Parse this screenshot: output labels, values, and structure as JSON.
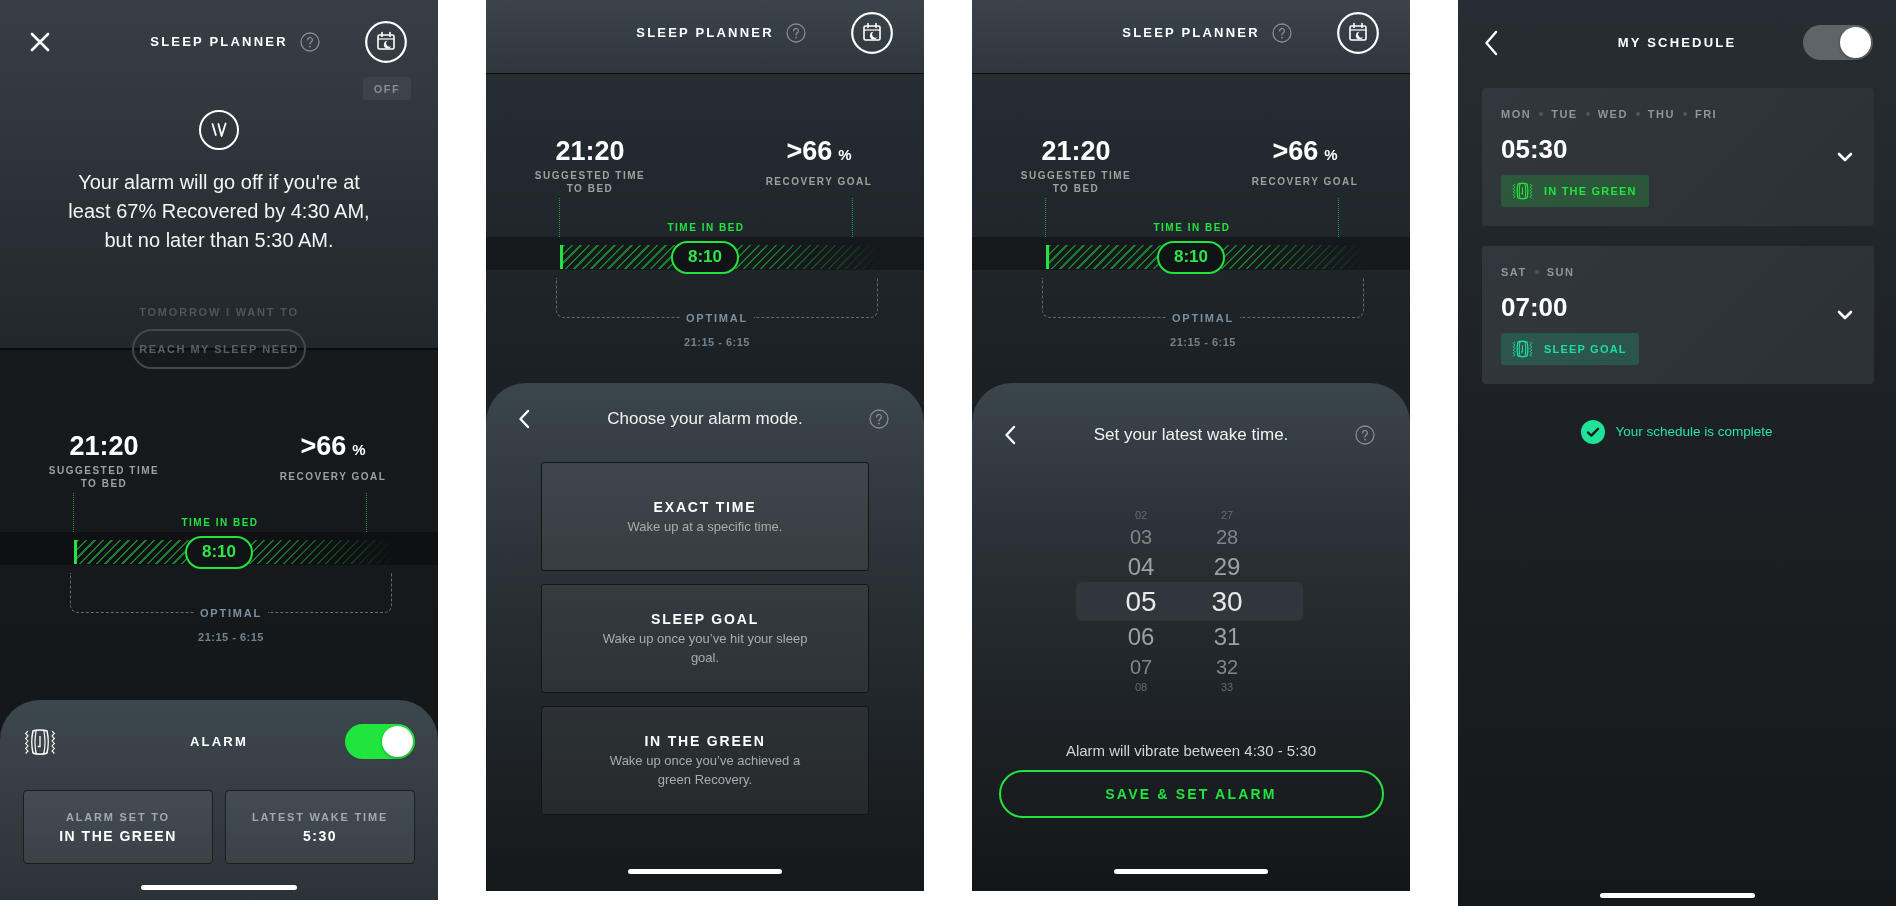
{
  "screens": [
    {
      "kind": "summary",
      "header": {
        "title": "SLEEP PLANNER",
        "badge": "OFF"
      },
      "message": "Your alarm will go off if you're at least 67% Recovered by 4:30 AM, but no later than 5:30 AM.",
      "prompt": {
        "label": "TOMORROW I WANT TO",
        "button": "REACH MY SLEEP NEED"
      },
      "plan": {
        "bedtime": "21:20",
        "bedtime_label": "SUGGESTED TIME TO BED",
        "recovery_goal": ">66",
        "recovery_unit": "%",
        "recovery_label": "RECOVERY GOAL",
        "time_in_bed_label": "TIME IN BED",
        "time_in_bed": "8:10",
        "optimal_label": "OPTIMAL",
        "optimal_range": "21:15 - 6:15"
      },
      "alarm": {
        "label": "ALARM",
        "on": true,
        "settings": [
          {
            "label": "ALARM SET TO",
            "value": "IN THE GREEN"
          },
          {
            "label": "LATEST WAKE TIME",
            "value": "5:30"
          }
        ]
      }
    },
    {
      "kind": "alarm_mode",
      "header": {
        "title": "SLEEP PLANNER"
      },
      "plan": {
        "bedtime": "21:20",
        "bedtime_label": "SUGGESTED TIME TO BED",
        "recovery_goal": ">66",
        "recovery_unit": "%",
        "recovery_label": "RECOVERY GOAL",
        "time_in_bed_label": "TIME IN BED",
        "time_in_bed": "8:10",
        "optimal_label": "OPTIMAL",
        "optimal_range": "21:15 - 6:15"
      },
      "sheet": {
        "title": "Choose your alarm mode.",
        "options": [
          {
            "title": "EXACT TIME",
            "description": "Wake up at a specific time."
          },
          {
            "title": "SLEEP GOAL",
            "description": "Wake up once you’ve hit your sleep goal."
          },
          {
            "title": "IN THE GREEN",
            "description": "Wake up once you’ve achieved a green Recovery."
          }
        ]
      }
    },
    {
      "kind": "wake_time",
      "header": {
        "title": "SLEEP PLANNER"
      },
      "plan": {
        "bedtime": "21:20",
        "bedtime_label": "SUGGESTED TIME TO BED",
        "recovery_goal": ">66",
        "recovery_unit": "%",
        "recovery_label": "RECOVERY GOAL",
        "time_in_bed_label": "TIME IN BED",
        "time_in_bed": "8:10",
        "optimal_label": "OPTIMAL",
        "optimal_range": "21:15 - 6:15"
      },
      "sheet": {
        "title": "Set your latest wake time.",
        "picker": {
          "hours": [
            {
              "value": "02",
              "selected": false
            },
            {
              "value": "03",
              "selected": false
            },
            {
              "value": "04",
              "selected": false
            },
            {
              "value": "05",
              "selected": true
            },
            {
              "value": "06",
              "selected": false
            },
            {
              "value": "07",
              "selected": false
            },
            {
              "value": "08",
              "selected": false
            }
          ],
          "minutes": [
            {
              "value": "27",
              "selected": false
            },
            {
              "value": "28",
              "selected": false
            },
            {
              "value": "29",
              "selected": false
            },
            {
              "value": "30",
              "selected": true
            },
            {
              "value": "31",
              "selected": false
            },
            {
              "value": "32",
              "selected": false
            },
            {
              "value": "33",
              "selected": false
            }
          ]
        },
        "note": "Alarm will vibrate between 4:30 - 5:30",
        "button": "SAVE & SET ALARM"
      }
    },
    {
      "kind": "schedule",
      "title": "MY SCHEDULE",
      "toggle": {
        "on": true
      },
      "entries": [
        {
          "days": [
            "MON",
            "TUE",
            "WED",
            "THU",
            "FRI"
          ],
          "time": "05:30",
          "mode": "IN THE GREEN",
          "color": "#22e33f"
        },
        {
          "days": [
            "SAT",
            "SUN"
          ],
          "time": "07:00",
          "mode": "SLEEP GOAL",
          "color": "#1fdc9f"
        }
      ],
      "status": "Your schedule is complete"
    }
  ]
}
